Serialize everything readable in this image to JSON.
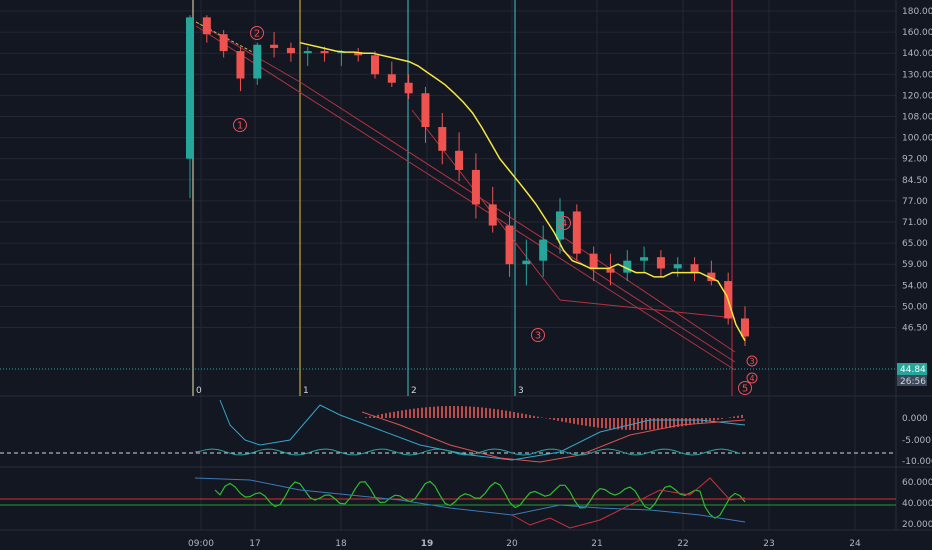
{
  "colors": {
    "background": "#131722",
    "grid": "#242733",
    "up": "#26a69a",
    "down": "#ef5350",
    "ema": "#f5e642",
    "channel": "#b2323f",
    "wave": "#e8505b",
    "cycle_zero": "#f0e6b0",
    "cycle_one": "#e3c63f",
    "cycle_cyan": "#3fc6c6",
    "cycle_red": "#c62f3c",
    "macd_line": "#35a7c9",
    "signal_line": "#d9534f",
    "rsi_green": "#2ebd2e",
    "rsi_red": "#c8323c",
    "rsi_blue": "#3a7ab8",
    "level_red": "#d03030",
    "level_green": "#2a9a2a",
    "badge_green": "#26a69a",
    "badge_gray": "#3c4a5c"
  },
  "price_axis": {
    "labels": [
      "180.00",
      "160.00",
      "140.00",
      "130.00",
      "120.00",
      "108.00",
      "100.00",
      "92.00",
      "84.50",
      "77.00",
      "71.00",
      "65.00",
      "59.00",
      "54.00",
      "50.00",
      "46.50"
    ],
    "current_price": "44.84",
    "countdown": "26:56"
  },
  "time_axis": {
    "labels": [
      "09:00",
      "17",
      "18",
      "19",
      "20",
      "21",
      "22",
      "23",
      "24"
    ]
  },
  "cycle_labels": [
    "0",
    "1",
    "2",
    "3"
  ],
  "elliott_waves": [
    "1",
    "2",
    "3",
    "4",
    "5"
  ],
  "fib_mini_labels": [
    "3",
    "4"
  ],
  "macd_axis": {
    "labels": [
      "0.000",
      "-5.000",
      "-10.000"
    ]
  },
  "rsi_axis": {
    "labels": [
      "60.000",
      "40.000",
      "20.000"
    ]
  },
  "chart_data": {
    "type": "candlestick",
    "ylim": [
      42,
      182
    ],
    "ema_values": [
      150,
      148,
      146,
      144,
      142,
      141,
      141,
      140,
      140,
      139,
      138,
      137,
      136,
      134,
      131,
      128,
      125,
      121,
      116,
      110,
      104,
      98,
      92,
      88,
      84,
      80,
      76,
      72,
      68,
      63,
      60,
      59,
      58,
      58,
      58,
      59,
      58,
      57,
      57,
      56,
      56,
      57,
      57,
      57,
      57,
      56,
      55,
      52,
      47,
      44
    ],
    "candles": [
      {
        "o": 92,
        "h": 176,
        "l": 78,
        "c": 174
      },
      {
        "o": 174,
        "h": 176,
        "l": 150,
        "c": 158
      },
      {
        "o": 158,
        "h": 162,
        "l": 138,
        "c": 142
      },
      {
        "o": 142,
        "h": 146,
        "l": 122,
        "c": 128
      },
      {
        "o": 128,
        "h": 150,
        "l": 125,
        "c": 148
      },
      {
        "o": 148,
        "h": 160,
        "l": 138,
        "c": 145
      },
      {
        "o": 145,
        "h": 150,
        "l": 136,
        "c": 140
      },
      {
        "o": 140,
        "h": 146,
        "l": 134,
        "c": 142
      },
      {
        "o": 142,
        "h": 146,
        "l": 136,
        "c": 140
      },
      {
        "o": 140,
        "h": 143,
        "l": 134,
        "c": 141
      },
      {
        "o": 141,
        "h": 145,
        "l": 136,
        "c": 139
      },
      {
        "o": 139,
        "h": 142,
        "l": 128,
        "c": 130
      },
      {
        "o": 130,
        "h": 136,
        "l": 124,
        "c": 126
      },
      {
        "o": 126,
        "h": 130,
        "l": 118,
        "c": 121
      },
      {
        "o": 121,
        "h": 124,
        "l": 98,
        "c": 104
      },
      {
        "o": 104,
        "h": 110,
        "l": 90,
        "c": 95
      },
      {
        "o": 95,
        "h": 102,
        "l": 84,
        "c": 88
      },
      {
        "o": 88,
        "h": 94,
        "l": 72,
        "c": 76
      },
      {
        "o": 76,
        "h": 82,
        "l": 68,
        "c": 70
      },
      {
        "o": 70,
        "h": 74,
        "l": 56,
        "c": 59
      },
      {
        "o": 59,
        "h": 66,
        "l": 54,
        "c": 60
      },
      {
        "o": 60,
        "h": 70,
        "l": 56,
        "c": 66
      },
      {
        "o": 66,
        "h": 78,
        "l": 62,
        "c": 74
      },
      {
        "o": 74,
        "h": 76,
        "l": 60,
        "c": 62
      },
      {
        "o": 62,
        "h": 64,
        "l": 55,
        "c": 58
      },
      {
        "o": 58,
        "h": 62,
        "l": 54,
        "c": 57
      },
      {
        "o": 57,
        "h": 63,
        "l": 55,
        "c": 60
      },
      {
        "o": 60,
        "h": 64,
        "l": 57,
        "c": 61
      },
      {
        "o": 61,
        "h": 63,
        "l": 56,
        "c": 58
      },
      {
        "o": 58,
        "h": 61,
        "l": 56,
        "c": 59
      },
      {
        "o": 59,
        "h": 61,
        "l": 55,
        "c": 57
      },
      {
        "o": 57,
        "h": 60,
        "l": 54,
        "c": 55
      },
      {
        "o": 55,
        "h": 57,
        "l": 47,
        "c": 48
      },
      {
        "o": 48,
        "h": 50,
        "l": 43,
        "c": 44.8
      }
    ]
  }
}
